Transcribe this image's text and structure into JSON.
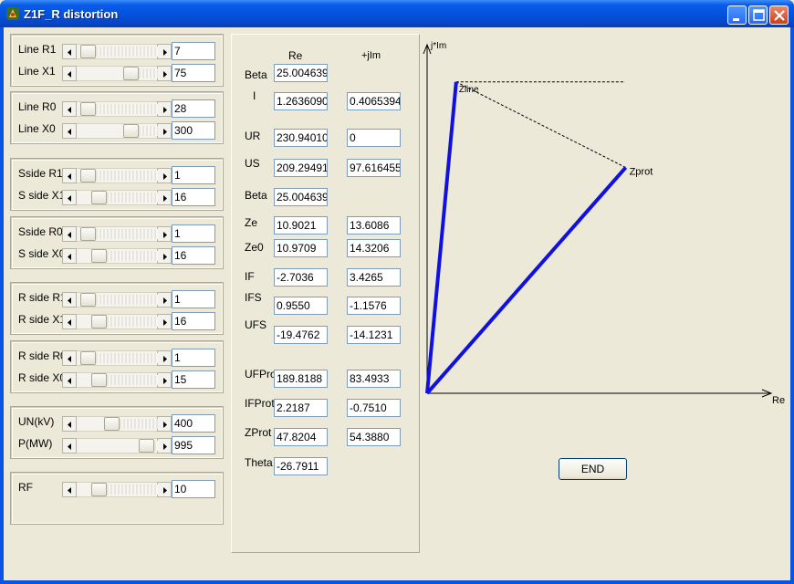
{
  "window": {
    "title": "Z1F_R distortion"
  },
  "left_panel": {
    "groups": [
      {
        "rows": [
          {
            "label": "Line R1",
            "value": "7",
            "thumb": 0.06
          },
          {
            "label": "Line X1",
            "value": "75",
            "thumb": 0.72
          }
        ]
      },
      {
        "rows": [
          {
            "label": "Line R0",
            "value": "28",
            "thumb": 0.06
          },
          {
            "label": "Line X0",
            "value": "300",
            "thumb": 0.72
          }
        ]
      },
      {
        "rows": [
          {
            "label": "Sside R1",
            "value": "1",
            "thumb": 0.06
          },
          {
            "label": "S side X1",
            "value": "16",
            "thumb": 0.22
          }
        ]
      },
      {
        "rows": [
          {
            "label": "Sside R0",
            "value": "1",
            "thumb": 0.06
          },
          {
            "label": "S side X0",
            "value": "16",
            "thumb": 0.22
          }
        ]
      },
      {
        "rows": [
          {
            "label": "R side R1",
            "value": "1",
            "thumb": 0.06
          },
          {
            "label": "R side X1",
            "value": "16",
            "thumb": 0.22
          }
        ]
      },
      {
        "rows": [
          {
            "label": "R side R0",
            "value": "1",
            "thumb": 0.06
          },
          {
            "label": "R side X0",
            "value": "15",
            "thumb": 0.22
          }
        ]
      },
      {
        "rows": [
          {
            "label": "UN(kV)",
            "value": "400",
            "thumb": 0.42
          },
          {
            "label": "P(MW)",
            "value": "995",
            "thumb": 0.96
          }
        ]
      },
      {
        "rows": [
          {
            "label": "RF",
            "value": "10",
            "thumb": 0.22
          }
        ]
      }
    ]
  },
  "results": {
    "col_re": "Re",
    "col_im": "+jIm",
    "rows": [
      {
        "label": "Beta",
        "re": "25.004639",
        "im": ""
      },
      {
        "label": "I",
        "re": "1.2636090",
        "im": "0.4065394"
      },
      {
        "label": "UR",
        "re": "230.94010",
        "im": "0"
      },
      {
        "label": "US",
        "re": "209.29491",
        "im": "97.616455"
      },
      {
        "label": "Beta",
        "re": "25.004639",
        "im": ""
      },
      {
        "label": "Ze",
        "re": "10.9021",
        "im": "13.6086"
      },
      {
        "label": "Ze0",
        "re": "10.9709",
        "im": "14.3206"
      },
      {
        "label": "IF",
        "re": "-2.7036",
        "im": "3.4265"
      },
      {
        "label": "IFS",
        "re": "0.9550",
        "im": "-1.1576"
      },
      {
        "label": "UFS",
        "re": "-19.4762",
        "im": "-14.1231"
      },
      {
        "label": "UFProt",
        "re": "189.8188",
        "im": "83.4933"
      },
      {
        "label": "IFProt",
        "re": "2.2187",
        "im": "-0.7510"
      },
      {
        "label": "ZProt",
        "re": "47.8204",
        "im": "54.3880"
      },
      {
        "label": "Theta",
        "re": "-26.7911",
        "im": ""
      }
    ]
  },
  "plot": {
    "y_axis_label": "j*Im",
    "x_axis_label": "Re",
    "zline_label": "Zline",
    "zprot_label": "Zprot",
    "vector_color": "#1010e0",
    "zline": {
      "re": 7,
      "im": 75
    },
    "zprot": {
      "re": 47.8204,
      "im": 54.388
    }
  },
  "end_button": {
    "label": "END"
  }
}
